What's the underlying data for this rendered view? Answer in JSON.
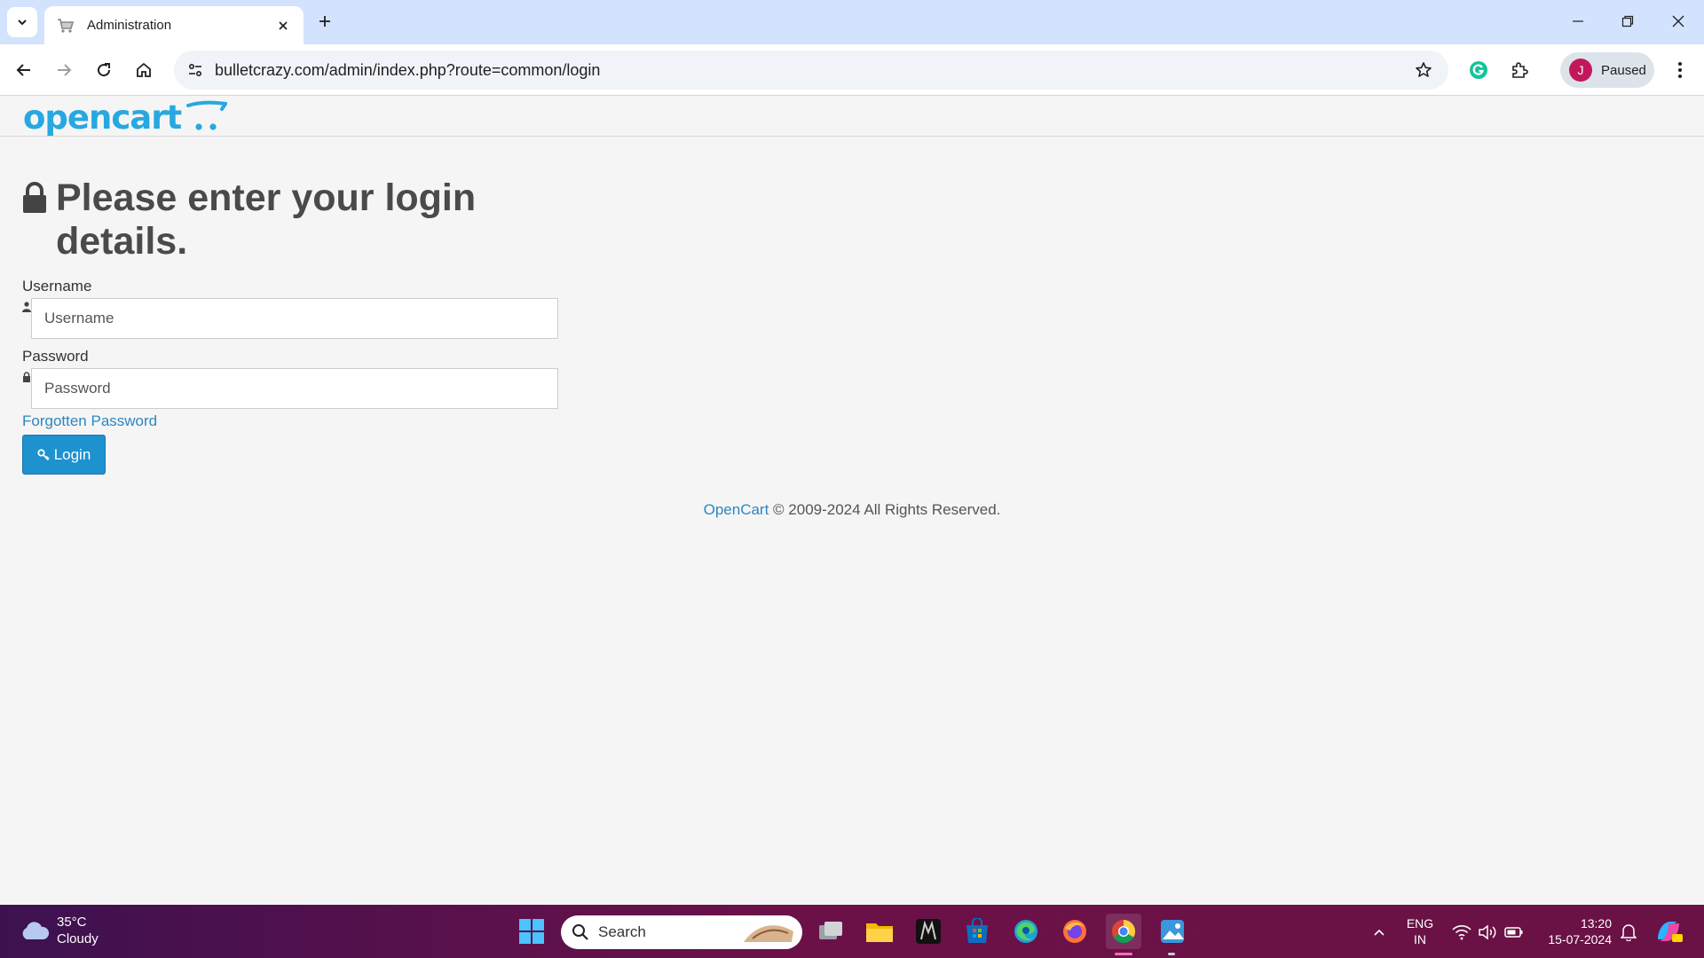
{
  "browser": {
    "tab_title": "Administration",
    "url": "bulletcrazy.com/admin/index.php?route=common/login",
    "profile_initial": "J",
    "profile_status": "Paused"
  },
  "page": {
    "logo_text": "opencart",
    "login_title": "Please enter your login details.",
    "username_label": "Username",
    "username_placeholder": "Username",
    "password_label": "Password",
    "password_placeholder": "Password",
    "forgotten_link": "Forgotten Password",
    "login_button": "Login",
    "footer_link": "OpenCart",
    "footer_text": " © 2009-2024 All Rights Reserved."
  },
  "taskbar": {
    "temperature": "35°C",
    "weather": "Cloudy",
    "search_label": "Search",
    "lang_primary": "ENG",
    "lang_secondary": "IN",
    "time": "13:20",
    "date": "15-07-2024"
  },
  "colors": {
    "accent": "#1e91cf",
    "link": "#2e86c1",
    "logo": "#27a8e0",
    "tabbar": "#d3e3fd"
  }
}
